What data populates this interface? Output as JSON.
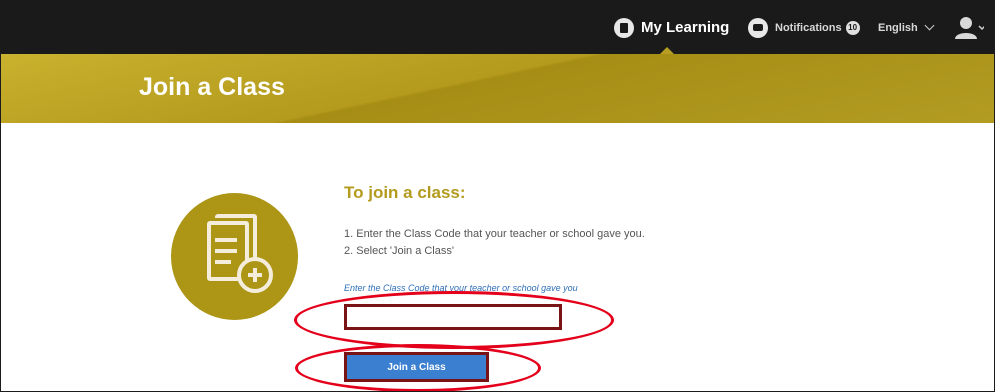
{
  "nav": {
    "my_learning": "My Learning",
    "notifications": "Notifications",
    "notification_count": "10",
    "language": "English",
    "icons": {
      "my_learning": "book-icon",
      "notifications": "chat-bubble-icon",
      "user": "user-avatar-icon",
      "dropdown": "chevron-down-icon"
    }
  },
  "banner": {
    "title": "Join a Class"
  },
  "content": {
    "heading": "To join a class:",
    "steps": [
      "1.  Enter the Class Code that your teacher or school gave you.",
      "2.  Select 'Join a Class'"
    ],
    "code_hint": "Enter the Class Code that your teacher or school gave you",
    "code_value": "",
    "join_button": "Join a Class"
  },
  "colors": {
    "topbar": "#1a1a1a",
    "accent_gold": "#b49a1d",
    "button_blue": "#3a7fd0",
    "highlight_red": "#e4001b"
  }
}
